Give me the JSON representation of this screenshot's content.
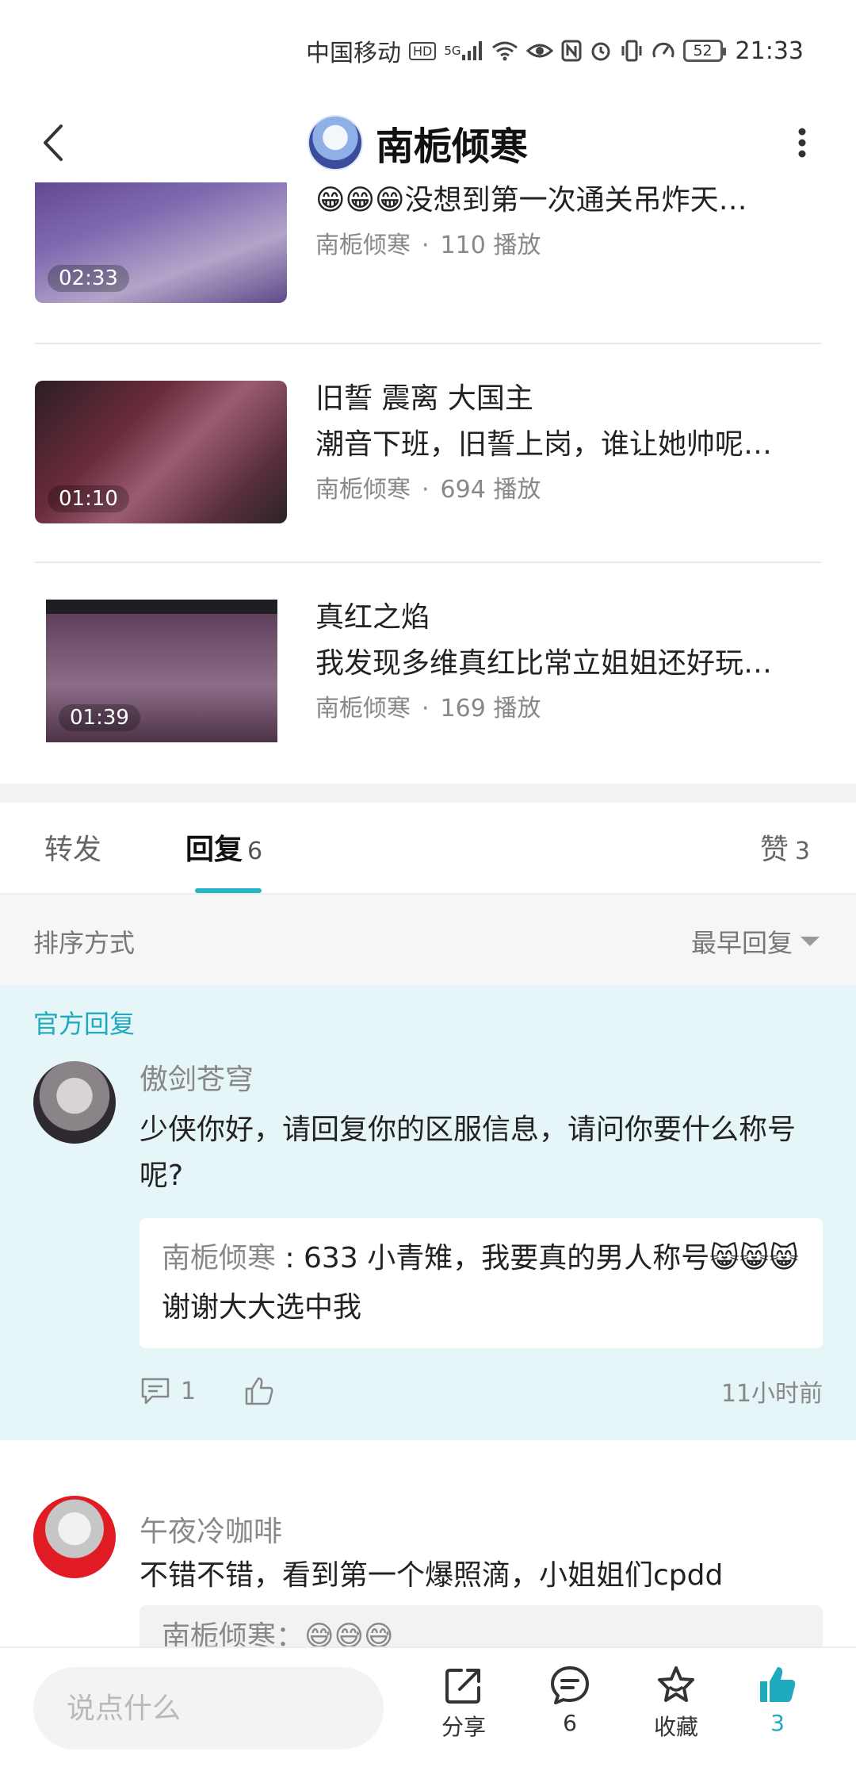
{
  "status_bar": {
    "carrier": "中国移动",
    "hd": "HD",
    "network": "5G",
    "battery": "52",
    "time": "21:33"
  },
  "header": {
    "title": "南栀倾寒"
  },
  "videos": [
    {
      "duration": "02:33",
      "line1": "😁😁😁没想到第一次通关吊炸天…",
      "line2": "",
      "author": "南栀倾寒",
      "plays": "110 播放"
    },
    {
      "duration": "01:10",
      "line1": "旧誓 震离  大国主",
      "line2": "潮音下班，旧誓上岗，谁让她帅呢…",
      "author": "南栀倾寒",
      "plays": "694 播放"
    },
    {
      "duration": "01:39",
      "line1": "真红之焰",
      "line2": "我发现多维真红比常立姐姐还好玩…",
      "author": "南栀倾寒",
      "plays": "169 播放"
    }
  ],
  "tabs": {
    "repost": "转发",
    "reply": "回复",
    "reply_count": "6",
    "like": "赞",
    "like_count": "3"
  },
  "sort": {
    "label": "排序方式",
    "value": "最早回复"
  },
  "official_reply": {
    "label": "官方回复",
    "username": "傲剑苍穹",
    "text": "少侠你好，请回复你的区服信息，请问你要什么称号呢?",
    "quote_name": "南栀倾寒",
    "quote_text": "633  小青雉，我要真的男人称号😸😸😸  谢谢大大选中我",
    "reply_count": "1",
    "time_ago": "11小时前"
  },
  "comment2": {
    "username": "午夜冷咖啡",
    "text": "不错不错，看到第一个爆照滴，小姐姐们cpdd",
    "quote_preview": "南栀倾寒：😅😅😅"
  },
  "bottom_bar": {
    "placeholder": "说点什么",
    "share": "分享",
    "reply_count": "6",
    "favorite": "收藏",
    "like_count": "3"
  },
  "colors": {
    "accent": "#20aabd",
    "official_bg": "#e6f5f8"
  },
  "icons": [
    "back-arrow-icon",
    "more-vertical-icon",
    "comment-icon",
    "thumbs-up-icon",
    "share-icon",
    "star-icon"
  ]
}
